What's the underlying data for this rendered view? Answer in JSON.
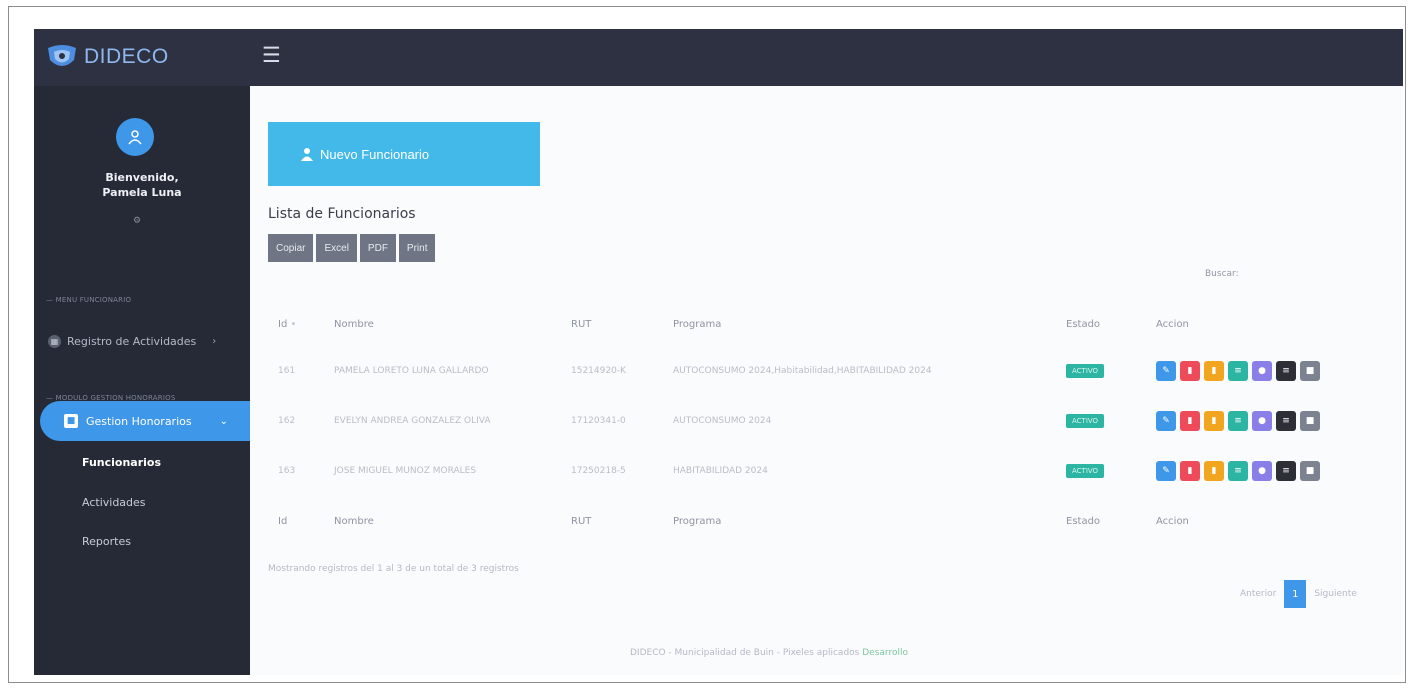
{
  "app": {
    "brand": "DIDECO"
  },
  "sidebar": {
    "welcome_line1": "Bienvenido,",
    "welcome_line2": "Pamela Luna",
    "section_funcionario": "MENU FUNCIONARIO",
    "registro_label": "Registro de Actividades",
    "section_honorarios": "MODULO GESTION HONORARIOS",
    "gestion_label": "Gestion Honorarios",
    "submenu": [
      "Funcionarios",
      "Actividades",
      "Reportes"
    ]
  },
  "main": {
    "new_button_label": "Nuevo Funcionario",
    "list_title": "Lista de Funcionarios",
    "export_buttons": [
      "Copiar",
      "Excel",
      "PDF",
      "Print"
    ],
    "search_label": "Buscar:",
    "columns": [
      "Id",
      "Nombre",
      "RUT",
      "Programa",
      "Estado",
      "Accion"
    ],
    "rows": [
      {
        "id": "161",
        "nombre": "PAMELA LORETO LUNA GALLARDO",
        "rut": "15214920-K",
        "programa": "AUTOCONSUMO 2024,Habitabilidad,HABITABILIDAD 2024",
        "estado": "ACTIVO"
      },
      {
        "id": "162",
        "nombre": "EVELYN ANDREA GONZALEZ OLIVA",
        "rut": "17120341-0",
        "programa": "AUTOCONSUMO 2024",
        "estado": "ACTIVO"
      },
      {
        "id": "163",
        "nombre": "JOSE MIGUEL MUNOZ MORALES",
        "rut": "17250218-5",
        "programa": "HABITABILIDAD 2024",
        "estado": "ACTIVO"
      }
    ],
    "showing_text": "Mostrando registros del 1 al 3 de un total de 3 registros",
    "pager": {
      "prev": "Anterior",
      "current": "1",
      "next": "Siguiente"
    },
    "footer_text": "DIDECO - Municipalidad de Buin - Pixeles aplicados",
    "footer_credit": "Desarrollo"
  },
  "colors": {
    "topbar": "#2d3142",
    "sidebar": "#262a37",
    "accent": "#3e97e9",
    "new_button": "#43b9e9",
    "status_active": "#2bb5a2",
    "action_buttons": [
      "#3e97e9",
      "#ee4a5a",
      "#f2a51f",
      "#2bb5a2",
      "#8a7fe8",
      "#2d2f36",
      "#7d8290"
    ]
  },
  "icons": {
    "row_actions": [
      "edit-icon",
      "delete-icon",
      "document-icon",
      "list-icon",
      "user-icon",
      "menu-icon",
      "comment-icon"
    ]
  }
}
